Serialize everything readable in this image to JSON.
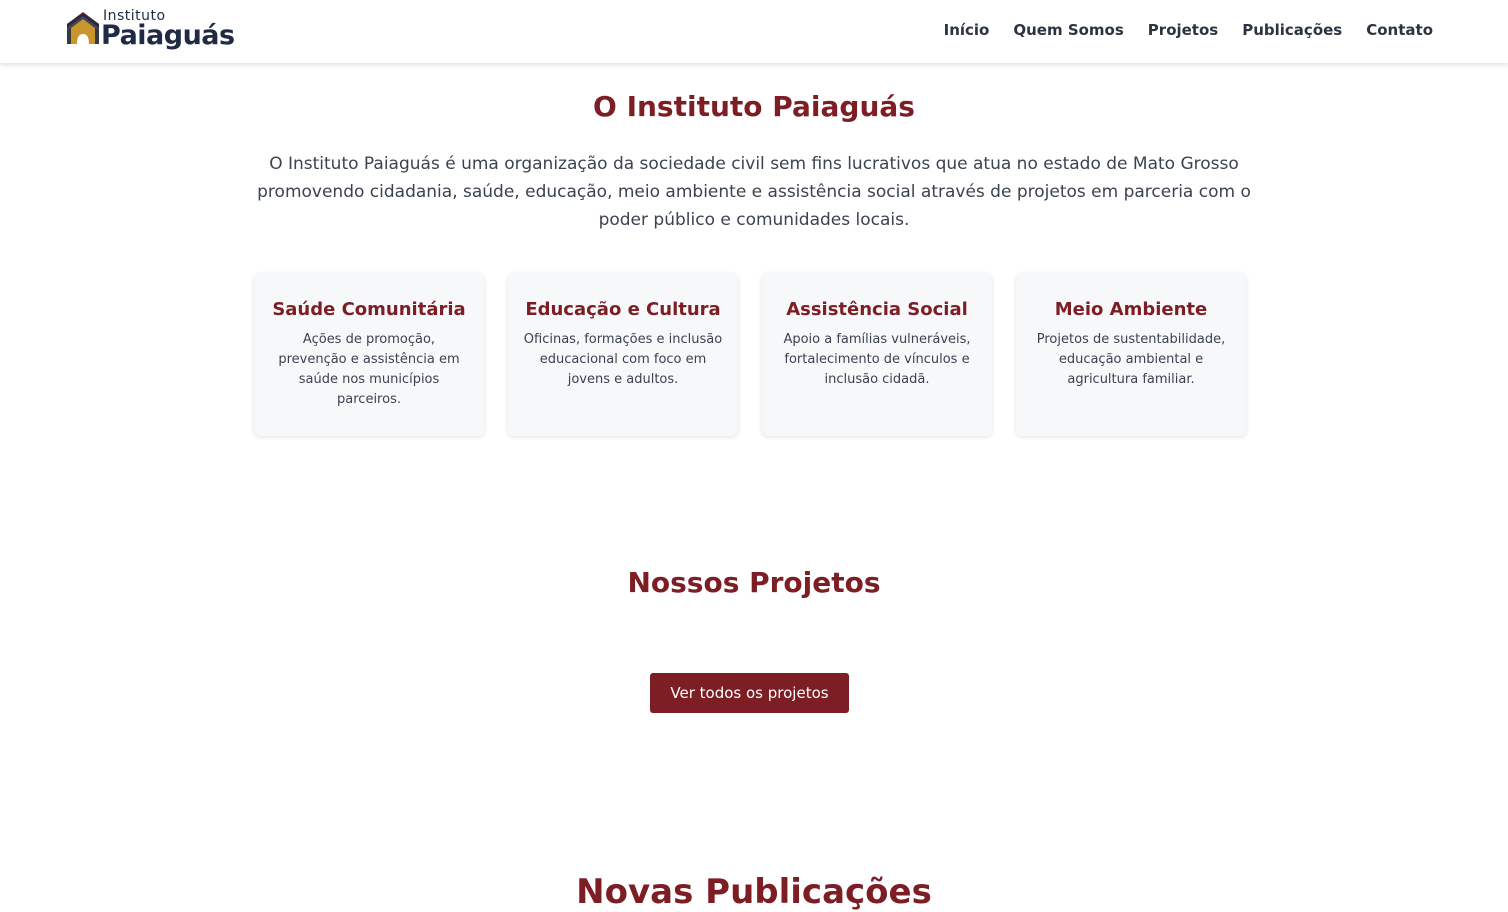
{
  "header": {
    "logo": {
      "small_text": "Instituto",
      "big_text": "Paiaguás"
    },
    "nav": [
      "Início",
      "Quem Somos",
      "Projetos",
      "Publicações",
      "Contato"
    ]
  },
  "about": {
    "title": "O Instituto Paiaguás",
    "text": "O Instituto Paiaguás é uma organização da sociedade civil sem fins lucrativos que atua no estado de Mato Grosso promovendo cidadania, saúde, educação, meio ambiente e assistência social através de projetos em parceria com o poder público e comunidades locais.",
    "cards": [
      {
        "title": "Saúde Comunitária",
        "text": "Ações de promoção, prevenção e assistência em saúde nos municípios parceiros."
      },
      {
        "title": "Educação e Cultura",
        "text": "Oficinas, formações e inclusão educacional com foco em jovens e adultos."
      },
      {
        "title": "Assistência Social",
        "text": "Apoio a famílias vulneráveis, fortalecimento de vínculos e inclusão cidadã."
      },
      {
        "title": "Meio Ambiente",
        "text": "Projetos de sustentabilidade, educação ambiental e agricultura familiar."
      }
    ]
  },
  "projects": {
    "title": "Nossos Projetos",
    "button_label": "Ver todos os projetos"
  },
  "publications": {
    "title": "Novas Publicações"
  },
  "colors": {
    "brand": "#7d1d24",
    "navy": "#1f2a44",
    "gold": "#c9962e"
  }
}
